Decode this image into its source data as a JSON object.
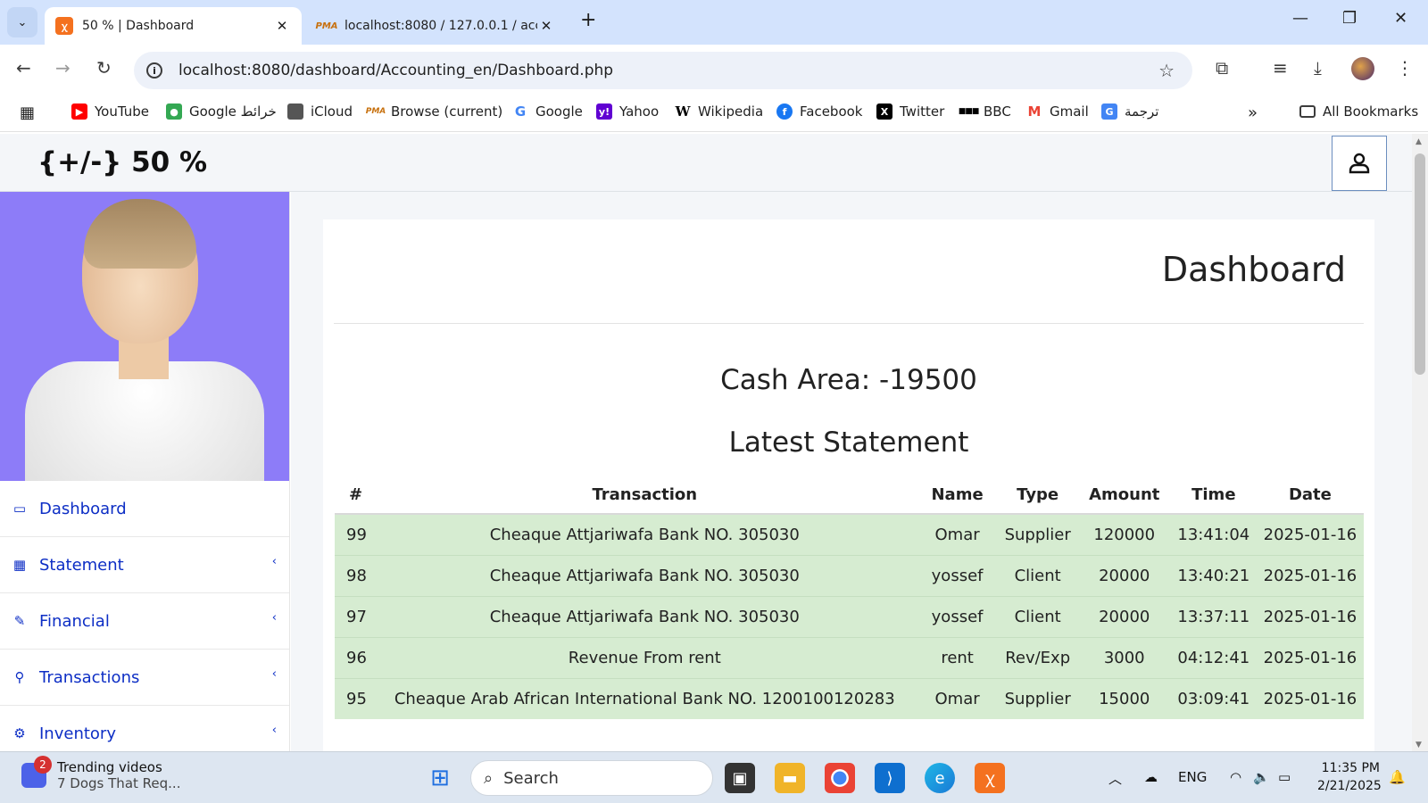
{
  "browser": {
    "tabs": [
      {
        "title": "50 % | Dashboard",
        "favicon": "xampp-icon",
        "active": true
      },
      {
        "title": "localhost:8080 / 127.0.0.1 / acc",
        "favicon": "phpmyadmin-icon",
        "active": false
      }
    ],
    "url": "localhost:8080/dashboard/Accounting_en/Dashboard.php",
    "bookmarks": [
      {
        "label": "YouTube",
        "icon": "youtube-icon",
        "color": "#ff0000"
      },
      {
        "label": "Google خرائط",
        "icon": "maps-icon",
        "color": "#34a853"
      },
      {
        "label": "iCloud",
        "icon": "apple-icon",
        "color": "#555555"
      },
      {
        "label": "Browse (current)",
        "icon": "phpmyadmin-icon",
        "color": "#c7700d"
      },
      {
        "label": "Google",
        "icon": "google-icon",
        "color": "#4285f4"
      },
      {
        "label": "Yahoo",
        "icon": "yahoo-icon",
        "color": "#6001d2"
      },
      {
        "label": "Wikipedia",
        "icon": "wikipedia-icon",
        "color": "#000000"
      },
      {
        "label": "Facebook",
        "icon": "facebook-icon",
        "color": "#1877f2"
      },
      {
        "label": "Twitter",
        "icon": "x-icon",
        "color": "#000000"
      },
      {
        "label": "BBC",
        "icon": "bbc-icon",
        "color": "#000000"
      },
      {
        "label": "Gmail",
        "icon": "gmail-icon",
        "color": "#ea4335"
      },
      {
        "label": "ترجمة",
        "icon": "translate-icon",
        "color": "#4285f4"
      }
    ],
    "all_bookmarks": "All Bookmarks"
  },
  "app": {
    "brand": "{+/-} 50 %",
    "sidebar": [
      {
        "label": "Dashboard",
        "icon": "desktop-icon",
        "has_chevron": false
      },
      {
        "label": "Statement",
        "icon": "table-icon",
        "has_chevron": true
      },
      {
        "label": "Financial",
        "icon": "edit-icon",
        "has_chevron": true
      },
      {
        "label": "Transactions",
        "icon": "sitemap-icon",
        "has_chevron": true
      },
      {
        "label": "Inventory",
        "icon": "gear-icon",
        "has_chevron": true
      }
    ],
    "page_title": "Dashboard",
    "cash_area": "Cash Area: -19500",
    "latest_title": "Latest Statement",
    "table": {
      "headers": [
        "#",
        "Transaction",
        "Name",
        "Type",
        "Amount",
        "Time",
        "Date"
      ],
      "rows": [
        [
          "99",
          "Cheaque Attjariwafa Bank NO. 305030",
          "Omar",
          "Supplier",
          "120000",
          "13:41:04",
          "2025-01-16"
        ],
        [
          "98",
          "Cheaque Attjariwafa Bank NO. 305030",
          "yossef",
          "Client",
          "20000",
          "13:40:21",
          "2025-01-16"
        ],
        [
          "97",
          "Cheaque Attjariwafa Bank NO. 305030",
          "yossef",
          "Client",
          "20000",
          "13:37:11",
          "2025-01-16"
        ],
        [
          "96",
          "Revenue From rent",
          "rent",
          "Rev/Exp",
          "3000",
          "04:12:41",
          "2025-01-16"
        ],
        [
          "95",
          "Cheaque Arab African International Bank NO. 1200100120283",
          "Omar",
          "Supplier",
          "15000",
          "03:09:41",
          "2025-01-16"
        ]
      ]
    }
  },
  "taskbar": {
    "news_badge": "2",
    "news_title": "Trending videos",
    "news_sub": "7 Dogs That Req...",
    "search_placeholder": "Search",
    "lang": "ENG",
    "time": "11:35 PM",
    "date": "2/21/2025"
  },
  "colors": {
    "accent": "#0d2ec5",
    "profile_bg": "#8d7cf8",
    "row_bg": "#d6ecd1",
    "tabbar": "#d3e3fd"
  }
}
